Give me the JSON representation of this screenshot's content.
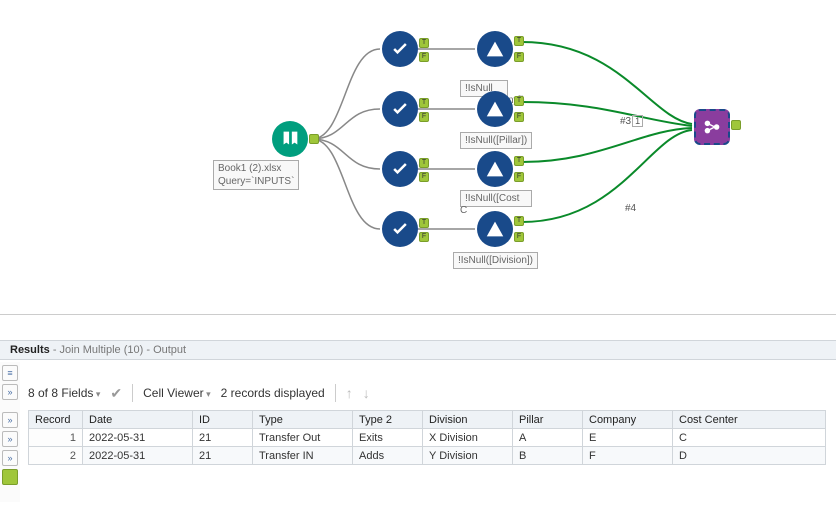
{
  "canvas": {
    "input_label": "Book1 (2).xlsx\nQuery=`INPUTS`",
    "formula_labels": [
      "!IsNull",
      "!IsNull([Pillar])",
      "!IsNull([Cost",
      "!IsNull([Division])"
    ],
    "partial_tag": "ny])",
    "partial_tag2": "C",
    "conn_anno1": "#3",
    "conn_anno1_suffix": "1",
    "conn_anno2": "#4",
    "anchor_t": "T",
    "anchor_f": "F"
  },
  "results": {
    "title": "Results",
    "subtitle": "- Join Multiple (10) - Output",
    "fields_summary": "8 of 8 Fields",
    "cell_viewer": "Cell Viewer",
    "records": "2 records displayed",
    "columns": [
      "Record",
      "Date",
      "ID",
      "Type",
      "Type 2",
      "Division",
      "Pillar",
      "Company",
      "Cost Center"
    ],
    "rows": [
      {
        "n": "1",
        "cells": [
          "2022-05-31",
          "21",
          "Transfer Out",
          "Exits",
          "X Division",
          "A",
          "E",
          "C"
        ]
      },
      {
        "n": "2",
        "cells": [
          "2022-05-31",
          "21",
          "Transfer IN",
          "Adds",
          "Y Division",
          "B",
          "F",
          "D"
        ]
      }
    ]
  },
  "chart_data": {
    "type": "table",
    "title": "Join Multiple (10) - Output",
    "columns": [
      "Record",
      "Date",
      "ID",
      "Type",
      "Type 2",
      "Division",
      "Pillar",
      "Company",
      "Cost Center"
    ],
    "rows": [
      [
        1,
        "2022-05-31",
        21,
        "Transfer Out",
        "Exits",
        "X Division",
        "A",
        "E",
        "C"
      ],
      [
        2,
        "2022-05-31",
        21,
        "Transfer IN",
        "Adds",
        "Y Division",
        "B",
        "F",
        "D"
      ]
    ]
  }
}
